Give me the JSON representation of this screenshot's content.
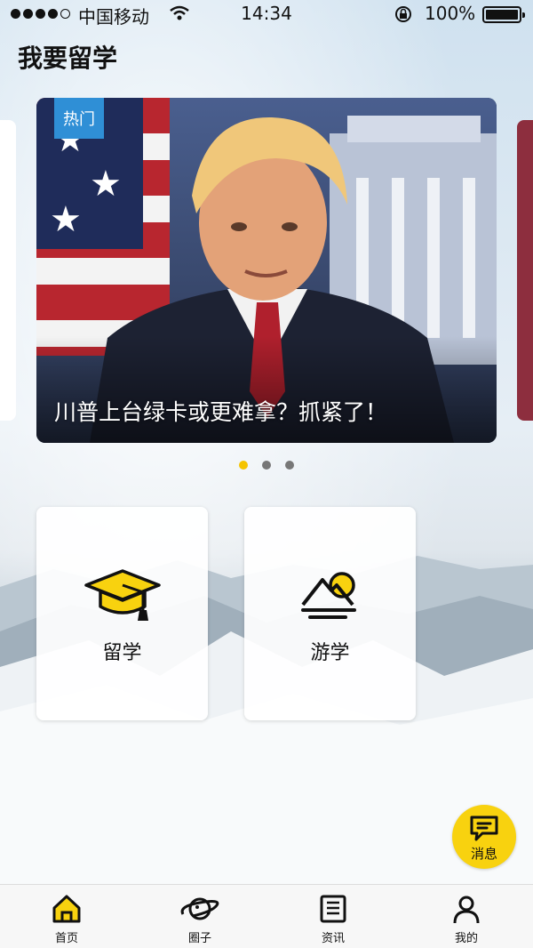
{
  "status_bar": {
    "carrier": "中国移动",
    "time": "14:34",
    "battery": "100%"
  },
  "page": {
    "title": "我要留学"
  },
  "banner": {
    "badge": "热门",
    "caption": "川普上台绿卡或更难拿？抓紧了！",
    "page_count": 3,
    "active_page": 1
  },
  "categories": [
    {
      "label": "留学",
      "icon": "graduation-cap-icon"
    },
    {
      "label": "游学",
      "icon": "mountain-sun-icon"
    }
  ],
  "message_button": {
    "label": "消息",
    "icon": "chat-bubble-icon",
    "color": "#f8d20f"
  },
  "tabbar": {
    "items": [
      {
        "label": "首页",
        "icon": "home-icon",
        "active": true
      },
      {
        "label": "圈子",
        "icon": "planet-icon"
      },
      {
        "label": "资讯",
        "icon": "news-icon"
      },
      {
        "label": "我的",
        "icon": "person-icon"
      }
    ]
  },
  "colors": {
    "accent": "#f5c400",
    "badge": "#2f8fd6"
  }
}
